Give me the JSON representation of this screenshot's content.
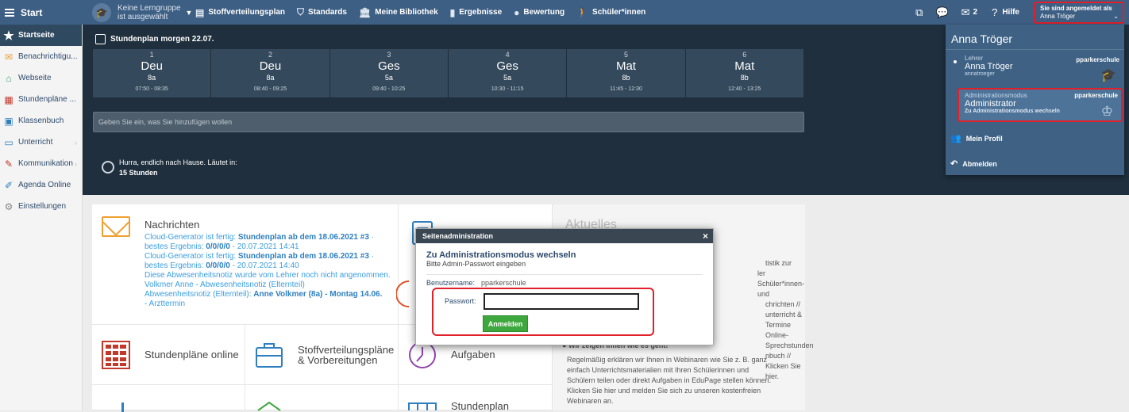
{
  "topbar": {
    "start": "Start",
    "group_line1": "Keine Lerngruppe",
    "group_line2": "ist ausgewählt",
    "nav": [
      {
        "label": "Stoffverteilungsplan",
        "icon": "folder-icon"
      },
      {
        "label": "Standards",
        "icon": "shield-icon"
      },
      {
        "label": "Meine Bibliothek",
        "icon": "library-icon"
      },
      {
        "label": "Ergebnisse",
        "icon": "bar-chart-icon"
      },
      {
        "label": "Bewertung",
        "icon": "grade-icon"
      },
      {
        "label": "Schüler*innen",
        "icon": "students-icon"
      }
    ],
    "message_count": "2",
    "help": "Hilfe",
    "logged_in_label": "Sie sind angemeldet als",
    "logged_in_user": "Anna Tröger"
  },
  "sidebar": {
    "items": [
      {
        "label": "Startseite",
        "icon": "star-icon"
      },
      {
        "label": "Benachrichtigu...",
        "icon": "envelope-icon"
      },
      {
        "label": "Webseite",
        "icon": "home-icon"
      },
      {
        "label": "Stundenpläne ...",
        "icon": "timetable-icon"
      },
      {
        "label": "Klassenbuch",
        "icon": "book-icon"
      },
      {
        "label": "Unterricht",
        "icon": "lesson-icon"
      },
      {
        "label": "Kommunikation",
        "icon": "chat-icon"
      },
      {
        "label": "Agenda Online",
        "icon": "pencil-icon"
      },
      {
        "label": "Einstellungen",
        "icon": "gear-icon"
      }
    ]
  },
  "schedule": {
    "title": "Stundenplan morgen 22.07.",
    "lessons": [
      {
        "num": "1",
        "subject": "Deu",
        "class": "8a",
        "time": "07:50 - 08:35"
      },
      {
        "num": "2",
        "subject": "Deu",
        "class": "8a",
        "time": "08:40 - 09:25"
      },
      {
        "num": "3",
        "subject": "Ges",
        "class": "5a",
        "time": "09:40 - 10:25"
      },
      {
        "num": "4",
        "subject": "Ges",
        "class": "5a",
        "time": "10:30 - 11:15"
      },
      {
        "num": "5",
        "subject": "Mat",
        "class": "8b",
        "time": "11:45 - 12:30"
      },
      {
        "num": "6",
        "subject": "Mat",
        "class": "8b",
        "time": "12:40 - 13:25"
      }
    ],
    "add_placeholder": "Geben Sie ein, was Sie hinzufügen wollen",
    "home_text": "Hurra, endlich nach Hause. Läutet in:",
    "home_time": "15 Stunden"
  },
  "dropdown": {
    "name": "Anna Tröger",
    "teacher_role": "Lehrer",
    "teacher_name": "Anna Tröger",
    "teacher_login": "annatroeger",
    "school": "pparkerschule",
    "admin_role": "Administrationsmodus",
    "admin_name": "Administrator",
    "admin_sub": "Zu Administrationsmodus wechseln",
    "profile": "Mein Profil",
    "logout": "Abmelden"
  },
  "messages": {
    "title": "Nachrichten",
    "l1": "Cloud-Generator ist fertig: ",
    "l1b": "Stundenplan ab dem 18.06.2021 #3",
    "l1c": " · bestes Ergebnis: ",
    "l1d": "0/0/0/0",
    "l1e": " - 20.07.2021 14:41",
    "l2": "Cloud-Generator ist fertig: ",
    "l2b": "Stundenplan ab dem 18.06.2021 #3",
    "l2c": " · bestes Ergebnis: ",
    "l2d": "0/0/0/0",
    "l2e": " - 20.07.2021 14:40",
    "l3": "Diese Abwesenheitsnotiz wurde vom Lehrer noch nicht angenommen.",
    "l4": "Volkmer Anne - Abwesenheitsnotiz (Elternteil)",
    "l5": "Abwesenheitsnotiz (Elternteil): ",
    "l5b": "Anne Volkmer (8a) - Montag 14.06.",
    "l6": "- Arzttermin"
  },
  "tiles": {
    "stundenplaene": "Stundenpläne online",
    "stoff1": "Stoffverteilungspläne",
    "stoff2": "& Vorbereitungen",
    "aufgaben": "Aufgaben",
    "stundenplan": "Stundenplan"
  },
  "news": {
    "title": "Aktuelles",
    "lines": [
      "tistik zur",
      "ler Schüler*innen- und",
      "chrichten //",
      "unterricht & Termine",
      "Online-Sprechstunden",
      "nbuch // Klicken Sie",
      "hier."
    ],
    "heading": "Wir zeigen Ihnen wie es geht!",
    "body": [
      "Regelmäßig erklären wir Ihnen in Webinaren wie Sie z. B. ganz",
      "einfach Unterrichtsmaterialien mit Ihren Schülerinnen und",
      "Schülern teilen oder direkt Aufgaben in EduPage stellen können.",
      "Klicken Sie hier und melden Sie sich zu unseren kostenfreien",
      "Webinaren an."
    ]
  },
  "modal": {
    "header": "Seitenadministration",
    "close": "×",
    "title": "Zu Administrationsmodus wechseln",
    "hint": "Bitte Admin-Passwort eingeben",
    "username_label": "Benutzername:",
    "username": "pparkerschule",
    "password_label": "Passwort:",
    "password_value": "",
    "submit": "Anmelden"
  },
  "colors": {
    "topbar": "#3e5f84",
    "dark_panel": "#1f2f3d",
    "highlight": "#e0202a",
    "button": "#3ea83e"
  }
}
